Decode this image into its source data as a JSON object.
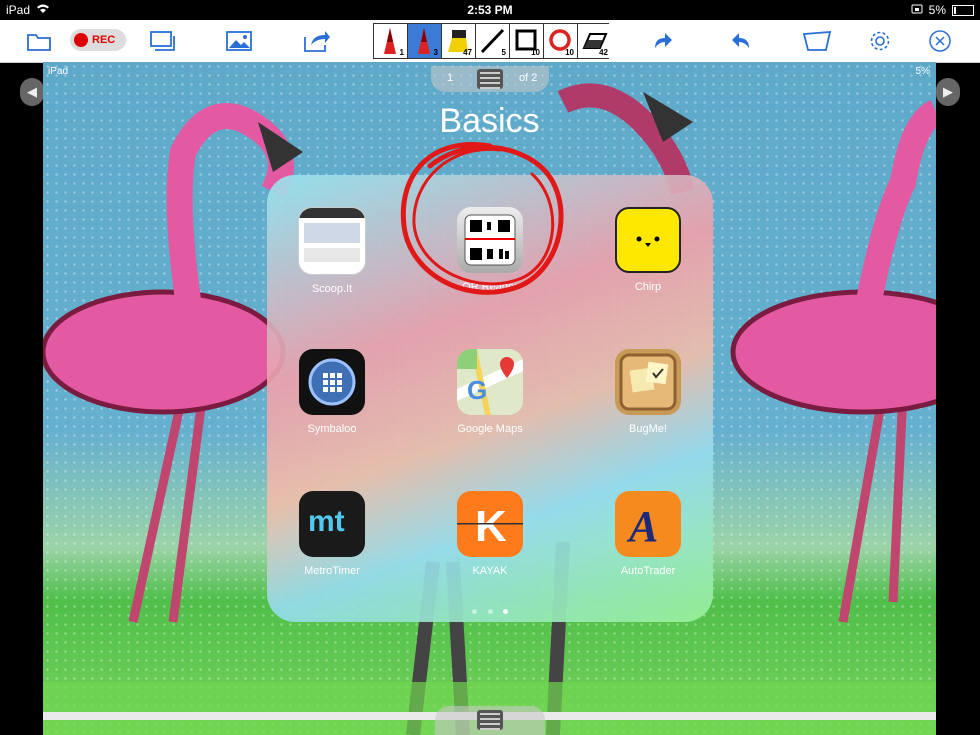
{
  "status": {
    "device": "iPad",
    "time": "2:53 PM",
    "battery": "5%"
  },
  "toolbar": {
    "rec_label": "REC",
    "pens": [
      {
        "name": "red-pen-icon",
        "size": "1"
      },
      {
        "name": "red-pen-icon",
        "size": "3"
      },
      {
        "name": "highlighter-icon",
        "size": "47"
      },
      {
        "name": "line-icon",
        "size": "5"
      },
      {
        "name": "rectangle-icon",
        "size": "10"
      },
      {
        "name": "circle-icon",
        "size": "10"
      },
      {
        "name": "eraser-icon",
        "size": "42"
      }
    ]
  },
  "screen": {
    "device": "iPad",
    "battery": "5%",
    "page_current": "1",
    "page_total": "of 2",
    "folder_title": "Basics"
  },
  "apps": [
    {
      "label": "Scoop.It"
    },
    {
      "label": "QR Reader"
    },
    {
      "label": "Chirp"
    },
    {
      "label": "Symbaloo"
    },
    {
      "label": "Google Maps"
    },
    {
      "label": "BugMe!"
    },
    {
      "label": "MetroTimer"
    },
    {
      "label": "KAYAK"
    },
    {
      "label": "AutoTrader"
    }
  ],
  "colors": {
    "accent": "#2a6fd6",
    "annotation": "#e01818",
    "rec": "#d00000"
  }
}
